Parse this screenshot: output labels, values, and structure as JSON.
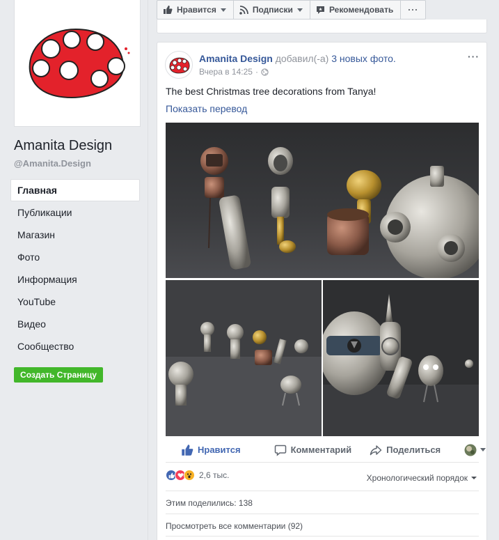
{
  "page": {
    "name": "Amanita Design",
    "handle": "@Amanita.Design"
  },
  "nav": {
    "items": [
      {
        "label": "Главная"
      },
      {
        "label": "Публикации"
      },
      {
        "label": "Магазин"
      },
      {
        "label": "Фото"
      },
      {
        "label": "Информация"
      },
      {
        "label": "YouTube"
      },
      {
        "label": "Видео"
      },
      {
        "label": "Сообщество"
      }
    ],
    "active_index": 0,
    "create_page_label": "Создать Страницу"
  },
  "top_bar": {
    "like_label": "Нравится",
    "follow_label": "Подписки",
    "recommend_label": "Рекомендовать",
    "more_label": "···"
  },
  "post": {
    "author": "Amanita Design",
    "action": "добавил(-а)",
    "action_link": "3 новых фото.",
    "time": "Вчера в 14:25",
    "meta_sep": "·",
    "menu": "···",
    "text": "The best Christmas tree decorations from Tanya!",
    "translate_label": "Показать перевод",
    "actions": {
      "like_label": "Нравится",
      "comment_label": "Комментарий",
      "share_label": "Поделиться"
    },
    "reactions_count": "2,6 тыс.",
    "order_label": "Хронологический порядок",
    "shares_label": "Этим поделились: 138",
    "view_comments_label": "Просмотреть все комментарии (92)"
  },
  "colors": {
    "link": "#365899",
    "like_blue": "#4267b2",
    "create_green": "#42b72a",
    "logo_red": "#e3222b"
  }
}
